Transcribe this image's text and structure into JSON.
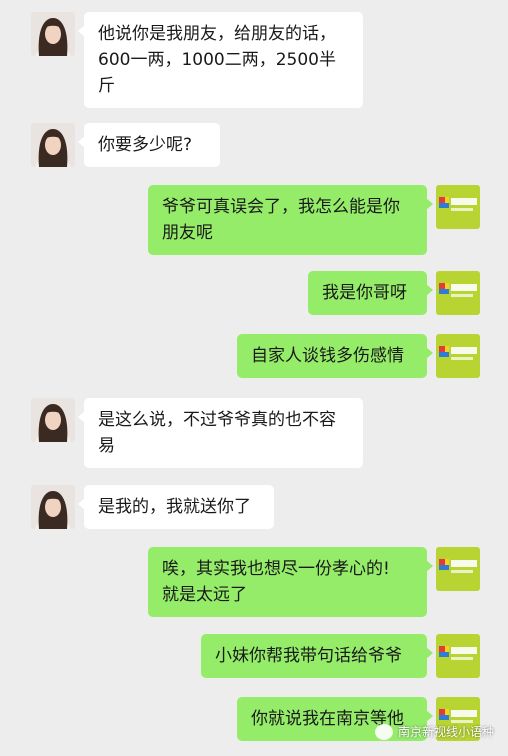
{
  "messages": [
    {
      "side": "left",
      "text": "他说你是我朋友，给朋友的话，\n600一两，1000二两，2500半\n斤"
    },
    {
      "side": "left",
      "text": "你要多少呢?"
    },
    {
      "side": "right",
      "text": "爷爷可真误会了，我怎么能是你\n朋友呢"
    },
    {
      "side": "right",
      "text": "我是你哥呀"
    },
    {
      "side": "right",
      "text": "自家人谈钱多伤感情"
    },
    {
      "side": "left",
      "text": "是这么说，不过爷爷真的也不容\n易"
    },
    {
      "side": "left",
      "text": "是我的，我就送你了"
    },
    {
      "side": "right",
      "text": "唉，其实我也想尽一份孝心的!\n就是太远了"
    },
    {
      "side": "right",
      "text": "小妹你帮我带句话给爷爷"
    },
    {
      "side": "right",
      "text": "你就说我在南京等他"
    }
  ],
  "right_avatar_text": "新视线教育",
  "watermark_text": "南京新视线小语种",
  "colors": {
    "background": "#ededed",
    "sent_bubble": "#95ec69",
    "received_bubble": "#ffffff",
    "avatar_green": "#b7d432"
  }
}
